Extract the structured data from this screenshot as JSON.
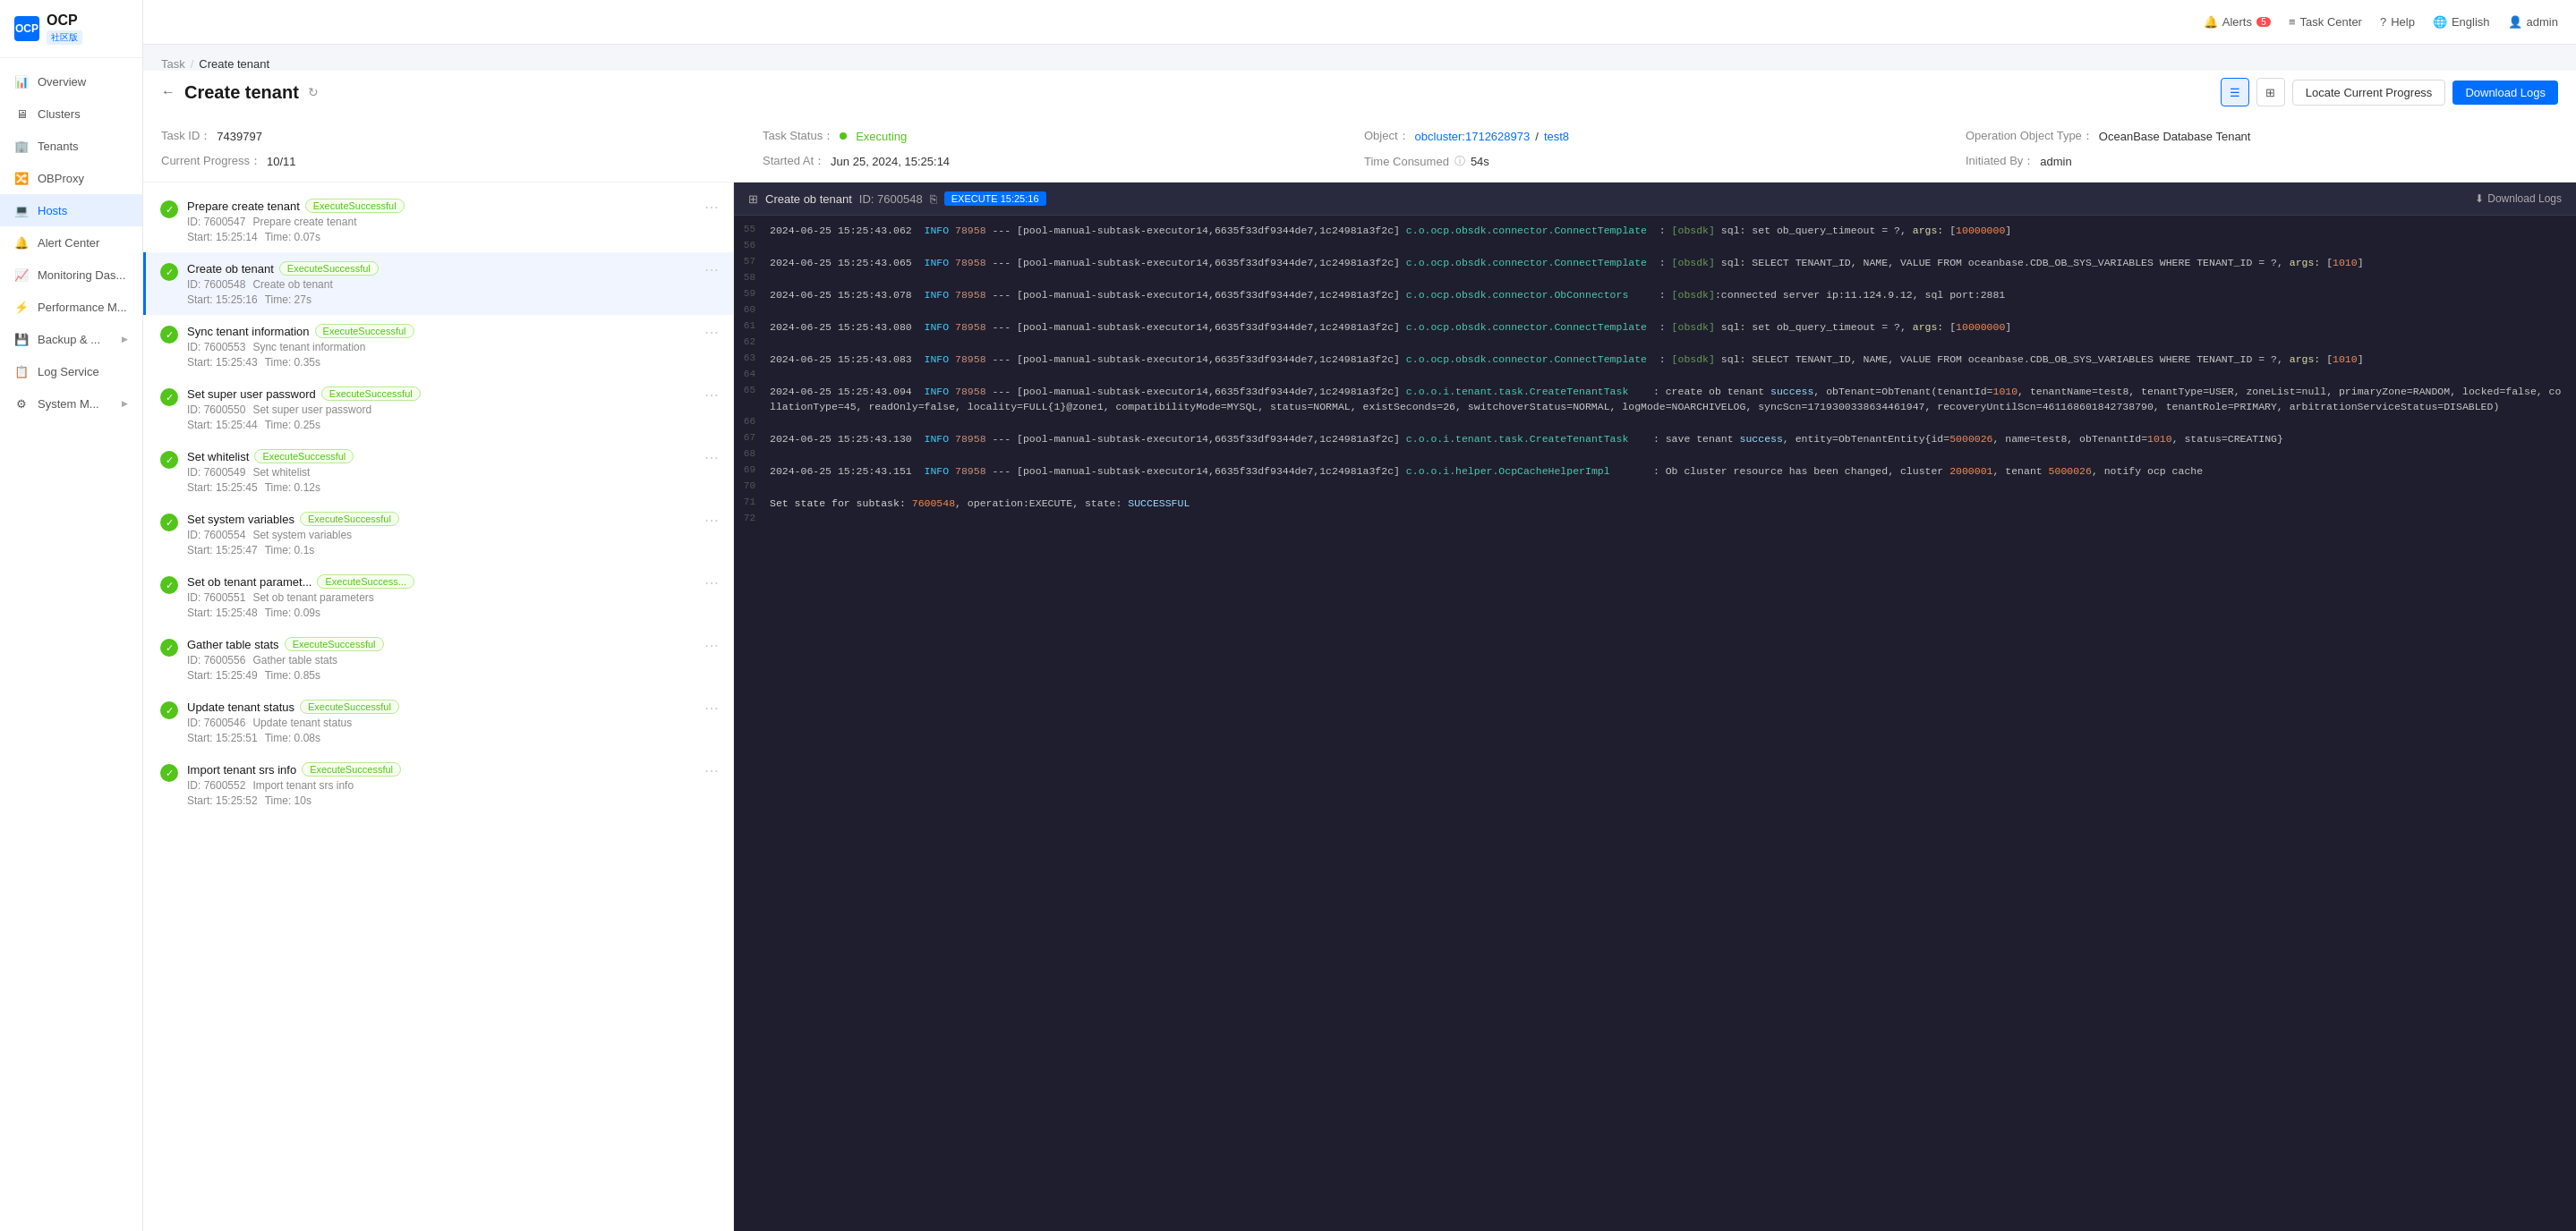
{
  "sidebar": {
    "logo": "OCP",
    "community": "社区版",
    "items": [
      {
        "id": "overview",
        "label": "Overview",
        "icon": "📊"
      },
      {
        "id": "clusters",
        "label": "Clusters",
        "icon": "🖥"
      },
      {
        "id": "tenants",
        "label": "Tenants",
        "icon": "🏢"
      },
      {
        "id": "obproxy",
        "label": "OBProxy",
        "icon": "🔀"
      },
      {
        "id": "hosts",
        "label": "Hosts",
        "icon": "💻",
        "active": true
      },
      {
        "id": "alert-center",
        "label": "Alert Center",
        "icon": "🔔"
      },
      {
        "id": "monitoring",
        "label": "Monitoring Das...",
        "icon": "📈"
      },
      {
        "id": "performance",
        "label": "Performance M...",
        "icon": "⚡"
      },
      {
        "id": "backup",
        "label": "Backup & ...",
        "icon": "💾",
        "hasChildren": true
      },
      {
        "id": "log-service",
        "label": "Log Service",
        "icon": "📋"
      },
      {
        "id": "system",
        "label": "System M...",
        "icon": "⚙",
        "hasChildren": true
      }
    ]
  },
  "topbar": {
    "alerts_label": "Alerts",
    "alerts_count": "5",
    "task_center": "Task Center",
    "help": "Help",
    "language": "English",
    "user": "admin"
  },
  "breadcrumb": {
    "parent": "Task",
    "current": "Create tenant"
  },
  "page": {
    "title": "Create tenant",
    "task_id_label": "Task ID：",
    "task_id": "7439797",
    "task_status_label": "Task Status：",
    "task_status": "Executing",
    "object_label": "Object：",
    "object_cluster": "obcluster:1712628973",
    "object_sep": " / ",
    "object_tenant": "test8",
    "op_type_label": "Operation Object Type：",
    "op_type": "OceanBase Database Tenant",
    "progress_label": "Current Progress：",
    "progress": "10/11",
    "started_label": "Started At：",
    "started": "Jun 25, 2024, 15:25:14",
    "time_label": "Time Consumed",
    "time_value": "54s",
    "initiated_label": "Initiated By：",
    "initiated": "admin",
    "locate_btn": "Locate Current Progress",
    "download_btn": "Download Logs"
  },
  "tasks": [
    {
      "id": 1,
      "name": "Prepare create tenant",
      "badge": "ExecuteSuccessful",
      "task_id": "ID: 7600547",
      "desc": "Prepare create tenant",
      "start": "Start: 15:25:14",
      "time": "Time: 0.07s"
    },
    {
      "id": 2,
      "name": "Create ob tenant",
      "badge": "ExecuteSuccessful",
      "task_id": "ID: 7600548",
      "desc": "Create ob tenant",
      "start": "Start: 15:25:16",
      "time": "Time: 27s",
      "active": true
    },
    {
      "id": 3,
      "name": "Sync tenant information",
      "badge": "ExecuteSuccessful",
      "task_id": "ID: 7600553",
      "desc": "Sync tenant information",
      "start": "Start: 15:25:43",
      "time": "Time: 0.35s"
    },
    {
      "id": 4,
      "name": "Set super user password",
      "badge": "ExecuteSuccessful",
      "task_id": "ID: 7600550",
      "desc": "Set super user password",
      "start": "Start: 15:25:44",
      "time": "Time: 0.25s"
    },
    {
      "id": 5,
      "name": "Set whitelist",
      "badge": "ExecuteSuccessful",
      "task_id": "ID: 7600549",
      "desc": "Set whitelist",
      "start": "Start: 15:25:45",
      "time": "Time: 0.12s"
    },
    {
      "id": 6,
      "name": "Set system variables",
      "badge": "ExecuteSuccessful",
      "task_id": "ID: 7600554",
      "desc": "Set system variables",
      "start": "Start: 15:25:47",
      "time": "Time: 0.1s"
    },
    {
      "id": 7,
      "name": "Set ob tenant paramet...",
      "badge": "ExecuteSuccess...",
      "task_id": "ID: 7600551",
      "desc": "Set ob tenant parameters",
      "start": "Start: 15:25:48",
      "time": "Time: 0.09s"
    },
    {
      "id": 8,
      "name": "Gather table stats",
      "badge": "ExecuteSuccessful",
      "task_id": "ID: 7600556",
      "desc": "Gather table stats",
      "start": "Start: 15:25:49",
      "time": "Time: 0.85s"
    },
    {
      "id": 9,
      "name": "Update tenant status",
      "badge": "ExecuteSuccessful",
      "task_id": "ID: 7600546",
      "desc": "Update tenant status",
      "start": "Start: 15:25:51",
      "time": "Time: 0.08s"
    },
    {
      "id": 10,
      "name": "Import tenant srs info",
      "badge": "ExecuteSuccessful",
      "task_id": "ID: 7600552",
      "desc": "Import tenant srs info",
      "start": "Start: 15:25:52",
      "time": "Time: 10s"
    }
  ],
  "log_panel": {
    "title": "Create ob tenant",
    "id": "ID: 7600548",
    "execute_badge": "EXECUTE 15:25:16",
    "download_label": "Download Logs",
    "lines": [
      {
        "num": 55,
        "content": "2024-06-25 15:25:43.062  INFO 78958 --- [pool-manual-subtask-executor14,6635f33df9344de7,1c24981a3f2c] c.o.ocp.obsdk.connector.ConnectTemplate  : [obsdk] sql: set ob_query_timeout = ?, args: [10000000]"
      },
      {
        "num": 56,
        "content": ""
      },
      {
        "num": 57,
        "content": "2024-06-25 15:25:43.065  INFO 78958 --- [pool-manual-subtask-executor14,6635f33df9344de7,1c24981a3f2c] c.o.ocp.obsdk.connector.ConnectTemplate  : [obsdk] sql: SELECT TENANT_ID, NAME, VALUE FROM oceanbase.CDB_OB_SYS_VARIABLES WHERE TENANT_ID = ?, args: [1010]"
      },
      {
        "num": 58,
        "content": ""
      },
      {
        "num": 59,
        "content": "2024-06-25 15:25:43.078  INFO 78958 --- [pool-manual-subtask-executor14,6635f33df9344de7,1c24981a3f2c] c.o.ocp.obsdk.connector.ObConnectors     : [obsdk]:connected server ip:11.124.9.12, sql port:2881"
      },
      {
        "num": 60,
        "content": ""
      },
      {
        "num": 61,
        "content": "2024-06-25 15:25:43.080  INFO 78958 --- [pool-manual-subtask-executor14,6635f33df9344de7,1c24981a3f2c] c.o.ocp.obsdk.connector.ConnectTemplate  : [obsdk] sql: set ob_query_timeout = ?, args: [10000000]"
      },
      {
        "num": 62,
        "content": ""
      },
      {
        "num": 63,
        "content": "2024-06-25 15:25:43.083  INFO 78958 --- [pool-manual-subtask-executor14,6635f33df9344de7,1c24981a3f2c] c.o.ocp.obsdk.connector.ConnectTemplate  : [obsdk] sql: SELECT TENANT_ID, NAME, VALUE FROM oceanbase.CDB_OB_SYS_VARIABLES WHERE TENANT_ID = ?, args: [1010]"
      },
      {
        "num": 64,
        "content": ""
      },
      {
        "num": 65,
        "content": "2024-06-25 15:25:43.094  INFO 78958 --- [pool-manual-subtask-executor14,6635f33df9344de7,1c24981a3f2c] c.o.o.i.tenant.task.CreateTenantTask    : create ob tenant success, obTenant=ObTenant(tenantId=1010, tenantName=test8, tenantType=USER, zoneList=null, primaryZone=RANDOM, locked=false, collationType=45, readOnly=false, locality=FULL{1}@zone1, compatibilityMode=MYSQL, status=NORMAL, existSeconds=26, switchoverStatus=NORMAL, logMode=NOARCHIVELOG, syncScn=1719300338634461947, recoveryUntilScn=461168601842738790, tenantRole=PRIMARY, arbitrationServiceStatus=DISABLED)"
      },
      {
        "num": 66,
        "content": ""
      },
      {
        "num": 67,
        "content": "2024-06-25 15:25:43.130  INFO 78958 --- [pool-manual-subtask-executor14,6635f33df9344de7,1c24981a3f2c] c.o.o.i.tenant.task.CreateTenantTask    : save tenant success, entity=ObTenantEntity{id=5000026, name=test8, obTenantId=1010, status=CREATING}"
      },
      {
        "num": 68,
        "content": ""
      },
      {
        "num": 69,
        "content": "2024-06-25 15:25:43.151  INFO 78958 --- [pool-manual-subtask-executor14,6635f33df9344de7,1c24981a3f2c] c.o.o.i.helper.OcpCacheHelperImpl       : Ob cluster resource has been changed, cluster 2000001, tenant 5000026, notify ocp cache"
      },
      {
        "num": 70,
        "content": ""
      },
      {
        "num": 71,
        "content": "Set state for subtask: 7600548, operation:EXECUTE, state: SUCCESSFUL"
      },
      {
        "num": 72,
        "content": ""
      }
    ]
  }
}
